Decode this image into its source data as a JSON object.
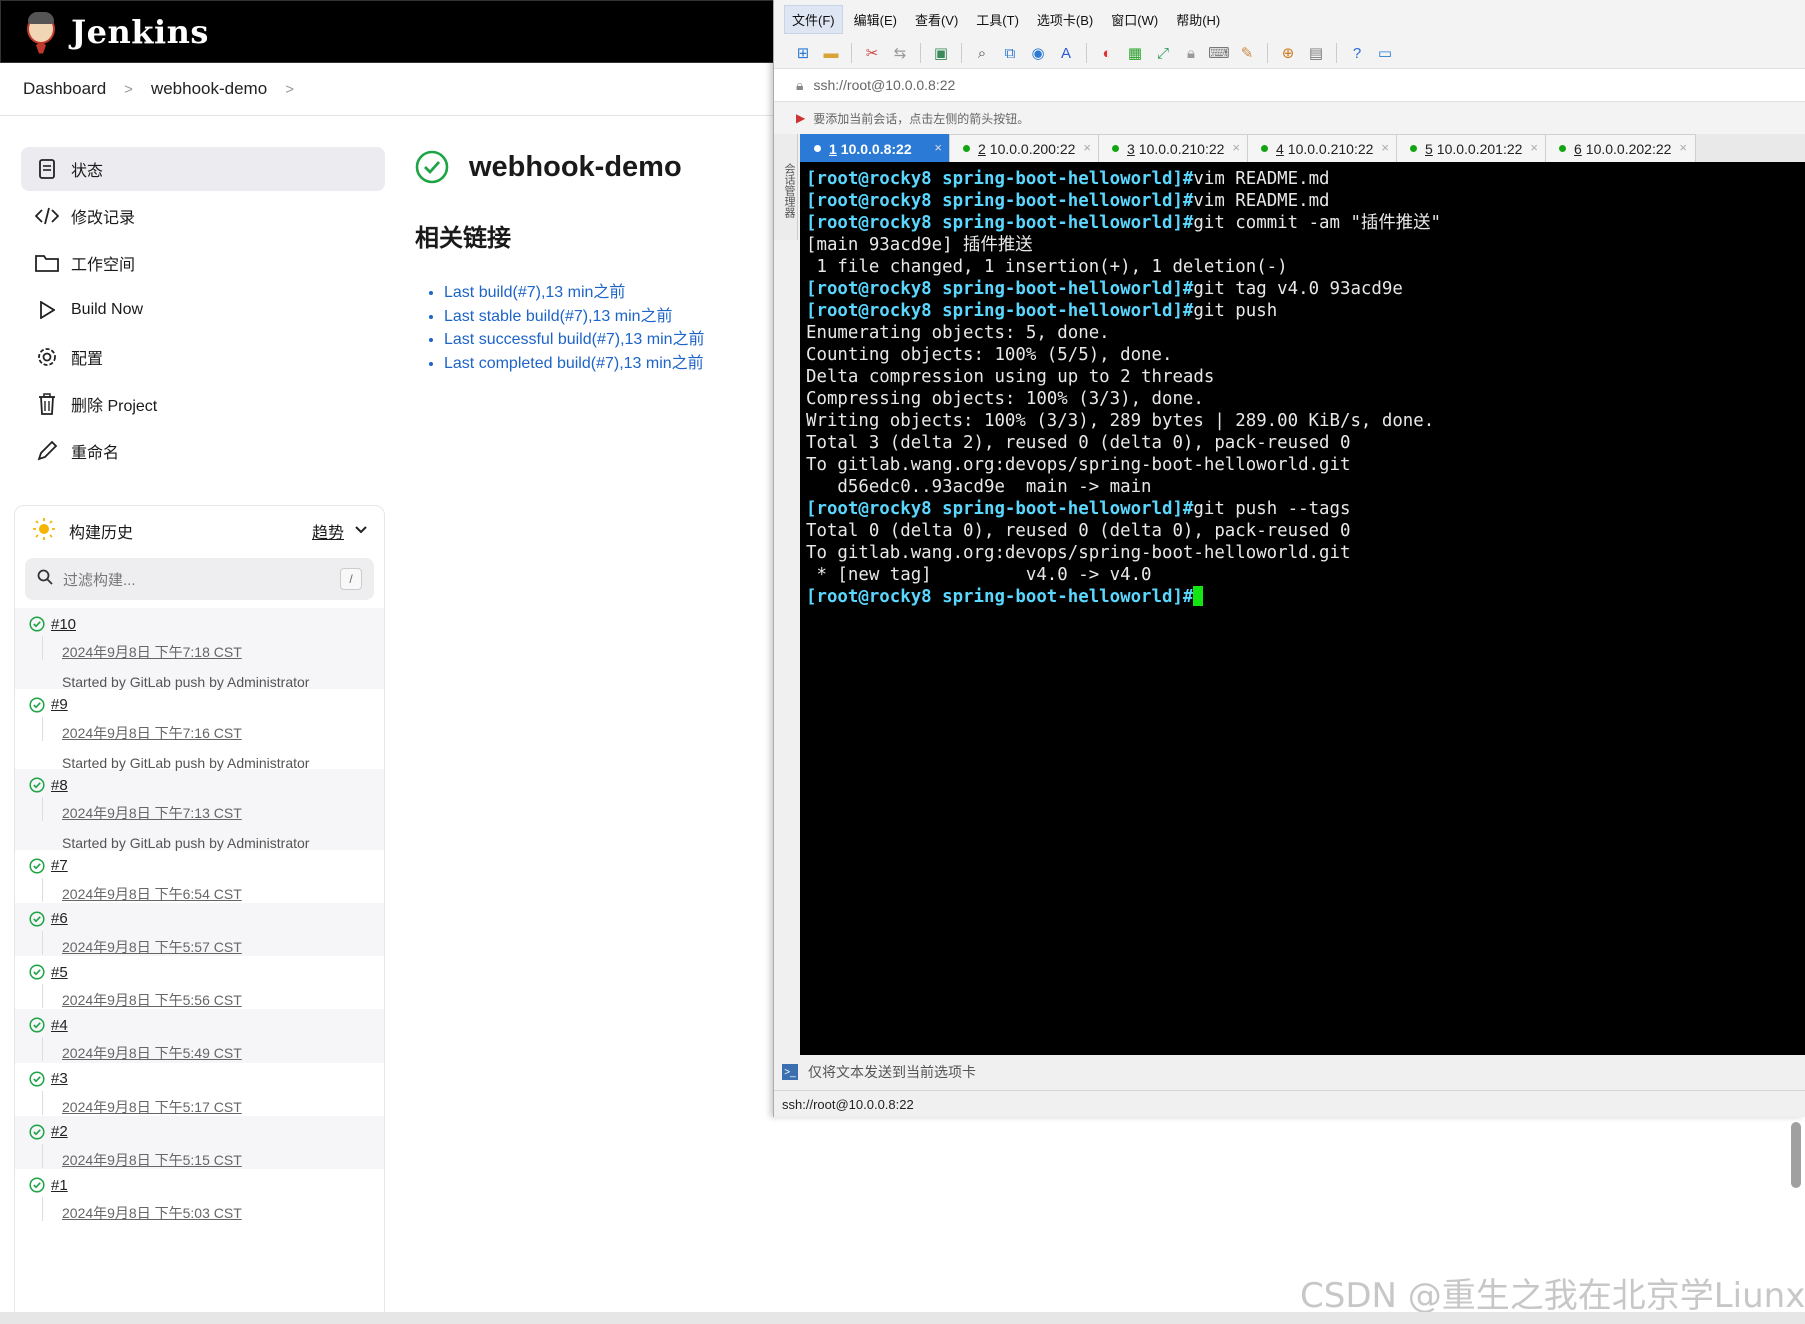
{
  "jenkins": {
    "app_title": "Jenkins",
    "breadcrumb": [
      "Dashboard",
      "webhook-demo"
    ],
    "tasks": [
      {
        "label": "状态",
        "icon": "document-icon"
      },
      {
        "label": "修改记录",
        "icon": "code-icon"
      },
      {
        "label": "工作空间",
        "icon": "folder-icon"
      },
      {
        "label": "Build Now",
        "icon": "play-icon"
      },
      {
        "label": "配置",
        "icon": "gear-icon"
      },
      {
        "label": "删除 Project",
        "icon": "trash-icon"
      },
      {
        "label": "重命名",
        "icon": "pencil-icon"
      }
    ],
    "history": {
      "title": "构建历史",
      "trend": "趋势",
      "filter_placeholder": "过滤构建...",
      "filter_shortcut": "/",
      "builds": [
        {
          "num": "#10",
          "date": "2024年9月8日 下午7:18 CST",
          "cause": "Started by GitLab push by Administrator"
        },
        {
          "num": "#9",
          "date": "2024年9月8日 下午7:16 CST",
          "cause": "Started by GitLab push by Administrator"
        },
        {
          "num": "#8",
          "date": "2024年9月8日 下午7:13 CST",
          "cause": "Started by GitLab push by Administrator"
        },
        {
          "num": "#7",
          "date": "2024年9月8日 下午6:54 CST"
        },
        {
          "num": "#6",
          "date": "2024年9月8日 下午5:57 CST"
        },
        {
          "num": "#5",
          "date": "2024年9月8日 下午5:56 CST"
        },
        {
          "num": "#4",
          "date": "2024年9月8日 下午5:49 CST"
        },
        {
          "num": "#3",
          "date": "2024年9月8日 下午5:17 CST"
        },
        {
          "num": "#2",
          "date": "2024年9月8日 下午5:15 CST"
        },
        {
          "num": "#1",
          "date": "2024年9月8日 下午5:03 CST"
        }
      ]
    },
    "main": {
      "title": "webhook-demo",
      "links_heading": "相关链接",
      "links": [
        "Last build(#7),13 min之前",
        "Last stable build(#7),13 min之前",
        "Last successful build(#7),13 min之前",
        "Last completed build(#7),13 min之前"
      ]
    },
    "colors": {
      "success": "#1ea446",
      "link": "#1d64c8"
    }
  },
  "xshell": {
    "menu": [
      "文件(F)",
      "编辑(E)",
      "查看(V)",
      "工具(T)",
      "选项卡(B)",
      "窗口(W)",
      "帮助(H)"
    ],
    "address": "ssh://root@10.0.0.8:22",
    "hint": "要添加当前会话，点击左侧的箭头按钮。",
    "side_label": "会话管理器",
    "tabs": [
      {
        "n": "1",
        "host": "10.0.0.8:22",
        "active": true
      },
      {
        "n": "2",
        "host": "10.0.0.200:22"
      },
      {
        "n": "3",
        "host": "10.0.0.210:22"
      },
      {
        "n": "4",
        "host": "10.0.0.210:22"
      },
      {
        "n": "5",
        "host": "10.0.0.201:22"
      },
      {
        "n": "6",
        "host": "10.0.0.202:22"
      }
    ],
    "prompt": "[root@rocky8 spring-boot-helloworld]#",
    "terminal": [
      {
        "prompt": true,
        "text": "vim README.md"
      },
      {
        "prompt": true,
        "text": "vim README.md"
      },
      {
        "prompt": true,
        "text": "git commit -am \"插件推送\""
      },
      {
        "text": "[main 93acd9e] 插件推送"
      },
      {
        "text": " 1 file changed, 1 insertion(+), 1 deletion(-)"
      },
      {
        "prompt": true,
        "text": "git tag v4.0 93acd9e"
      },
      {
        "prompt": true,
        "text": "git push"
      },
      {
        "text": "Enumerating objects: 5, done."
      },
      {
        "text": "Counting objects: 100% (5/5), done."
      },
      {
        "text": "Delta compression using up to 2 threads"
      },
      {
        "text": "Compressing objects: 100% (3/3), done."
      },
      {
        "text": "Writing objects: 100% (3/3), 289 bytes | 289.00 KiB/s, done."
      },
      {
        "text": "Total 3 (delta 2), reused 0 (delta 0), pack-reused 0"
      },
      {
        "text": "To gitlab.wang.org:devops/spring-boot-helloworld.git"
      },
      {
        "text": "   d56edc0..93acd9e  main -> main"
      },
      {
        "prompt": true,
        "text": "git push --tags"
      },
      {
        "text": "Total 0 (delta 0), reused 0 (delta 0), pack-reused 0"
      },
      {
        "text": "To gitlab.wang.org:devops/spring-boot-helloworld.git"
      },
      {
        "text": " * [new tag]         v4.0 -> v4.0"
      },
      {
        "prompt": true,
        "text": "",
        "cursor": true
      }
    ],
    "send_bar": "仅将文本发送到当前选项卡",
    "status": "ssh://root@10.0.0.8:22",
    "colors": {
      "active_tab": "#2a7ad6",
      "prompt": "#5ad7ff",
      "cursor": "#12e612"
    }
  },
  "watermark": "CSDN @重生之我在北京学Liunx"
}
